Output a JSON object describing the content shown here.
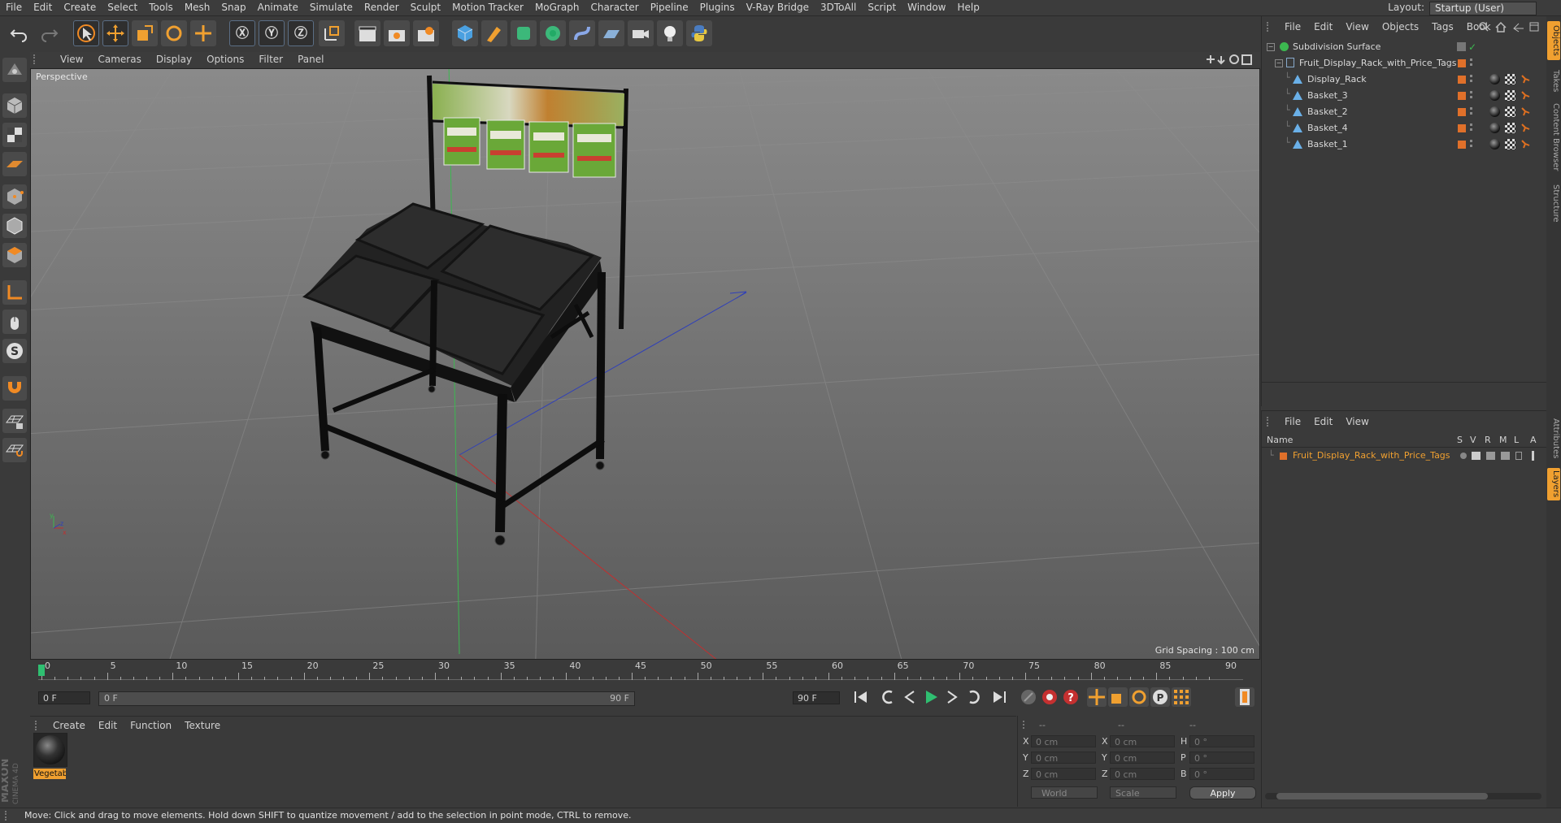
{
  "menubar": {
    "items": [
      "File",
      "Edit",
      "Create",
      "Select",
      "Tools",
      "Mesh",
      "Snap",
      "Animate",
      "Simulate",
      "Render",
      "Sculpt",
      "Motion Tracker",
      "MoGraph",
      "Character",
      "Pipeline",
      "Plugins",
      "V-Ray Bridge",
      "3DToAll",
      "Script",
      "Window",
      "Help"
    ],
    "layout_label": "Layout:",
    "layout_value": "Startup (User)"
  },
  "viewport": {
    "menu": [
      "View",
      "Cameras",
      "Display",
      "Options",
      "Filter",
      "Panel"
    ],
    "camera_label": "Perspective",
    "grid_spacing": "Grid Spacing : 100 cm"
  },
  "timeline": {
    "ticks": [
      "0",
      "5",
      "10",
      "15",
      "20",
      "25",
      "30",
      "35",
      "40",
      "45",
      "50",
      "55",
      "60",
      "65",
      "70",
      "75",
      "80",
      "85",
      "90"
    ],
    "current_frame_field": "0 F",
    "start_field": "0 F",
    "range_start": "0 F",
    "range_end": "90 F",
    "end_field": "90 F"
  },
  "materials": {
    "menu": [
      "Create",
      "Edit",
      "Function",
      "Texture"
    ],
    "items": [
      {
        "name": "Vegetab"
      }
    ]
  },
  "coords": {
    "header": [
      "--",
      "--",
      "--"
    ],
    "rows": [
      {
        "a": "X",
        "av": "0 cm",
        "b": "X",
        "bv": "0 cm",
        "c": "H",
        "cv": "0 °"
      },
      {
        "a": "Y",
        "av": "0 cm",
        "b": "Y",
        "bv": "0 cm",
        "c": "P",
        "cv": "0 °"
      },
      {
        "a": "Z",
        "av": "0 cm",
        "b": "Z",
        "bv": "0 cm",
        "c": "B",
        "cv": "0 °"
      }
    ],
    "space": "World",
    "mode": "Scale",
    "apply": "Apply"
  },
  "objects": {
    "menu": [
      "File",
      "Edit",
      "View",
      "Objects",
      "Tags",
      "Book"
    ],
    "tree": [
      {
        "name": "Subdivision Surface",
        "level": 0
      },
      {
        "name": "Fruit_Display_Rack_with_Price_Tags",
        "level": 1
      },
      {
        "name": "Display_Rack",
        "level": 2
      },
      {
        "name": "Basket_3",
        "level": 2
      },
      {
        "name": "Basket_2",
        "level": 2
      },
      {
        "name": "Basket_4",
        "level": 2
      },
      {
        "name": "Basket_1",
        "level": 2
      }
    ]
  },
  "layers": {
    "menu": [
      "File",
      "Edit",
      "View"
    ],
    "columns": [
      "Name",
      "S",
      "V",
      "R",
      "M",
      "L",
      "A"
    ],
    "rows": [
      {
        "name": "Fruit_Display_Rack_with_Price_Tags"
      }
    ]
  },
  "right_tabs": [
    "Objects",
    "Takes",
    "Content Browser",
    "Structure",
    "Attributes",
    "Layers"
  ],
  "status": "Move: Click and drag to move elements. Hold down SHIFT to quantize movement / add to the selection in point mode, CTRL to remove.",
  "brand": {
    "line1": "MAXON",
    "line2": "CINEMA 4D"
  },
  "colors": {
    "accent": "#f08a24",
    "bg": "#3a3a3a",
    "viewport": "#6b6b6b",
    "select": "#f0a030"
  }
}
